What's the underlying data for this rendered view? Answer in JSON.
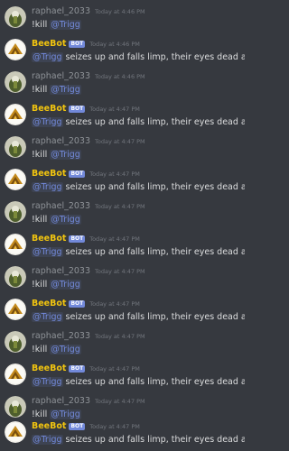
{
  "messages": [
    {
      "author": "raphael_2033",
      "type": "user",
      "time": "Today at 4:46 PM",
      "prefix": "!kill ",
      "mention": "@Trigg",
      "suffix": ""
    },
    {
      "author": "BeeBot",
      "type": "bot",
      "badge": "BOT",
      "time": "Today at 4:46 PM",
      "prefix": "",
      "mention": "@Trigg",
      "suffix": " seizes up and falls limp, their eyes dead and lifeless..."
    },
    {
      "author": "raphael_2033",
      "type": "user",
      "time": "Today at 4:46 PM",
      "prefix": "!kill ",
      "mention": "@Trigg",
      "suffix": ""
    },
    {
      "author": "BeeBot",
      "type": "bot",
      "badge": "BOT",
      "time": "Today at 4:47 PM",
      "prefix": "",
      "mention": "@Trigg",
      "suffix": " seizes up and falls limp, their eyes dead and lifeless..."
    },
    {
      "author": "raphael_2033",
      "type": "user",
      "time": "Today at 4:47 PM",
      "prefix": "!kill ",
      "mention": "@Trigg",
      "suffix": ""
    },
    {
      "author": "BeeBot",
      "type": "bot",
      "badge": "BOT",
      "time": "Today at 4:47 PM",
      "prefix": "",
      "mention": "@Trigg",
      "suffix": " seizes up and falls limp, their eyes dead and lifeless..."
    },
    {
      "author": "raphael_2033",
      "type": "user",
      "time": "Today at 4:47 PM",
      "prefix": "!kill ",
      "mention": "@Trigg",
      "suffix": ""
    },
    {
      "author": "BeeBot",
      "type": "bot",
      "badge": "BOT",
      "time": "Today at 4:47 PM",
      "prefix": "",
      "mention": "@Trigg",
      "suffix": " seizes up and falls limp, their eyes dead and lifeless..."
    },
    {
      "author": "raphael_2033",
      "type": "user",
      "time": "Today at 4:47 PM",
      "prefix": "!kill ",
      "mention": "@Trigg",
      "suffix": ""
    },
    {
      "author": "BeeBot",
      "type": "bot",
      "badge": "BOT",
      "time": "Today at 4:47 PM",
      "prefix": "",
      "mention": "@Trigg",
      "suffix": " seizes up and falls limp, their eyes dead and lifeless..."
    },
    {
      "author": "raphael_2033",
      "type": "user",
      "time": "Today at 4:47 PM",
      "prefix": "!kill ",
      "mention": "@Trigg",
      "suffix": ""
    },
    {
      "author": "BeeBot",
      "type": "bot",
      "badge": "BOT",
      "time": "Today at 4:47 PM",
      "prefix": "",
      "mention": "@Trigg",
      "suffix": " seizes up and falls limp, their eyes dead and lifeless..."
    },
    {
      "author": "raphael_2033",
      "type": "user",
      "time": "Today at 4:47 PM",
      "prefix": "!kill ",
      "mention": "@Trigg",
      "suffix": ""
    },
    {
      "author": "BeeBot",
      "type": "bot",
      "badge": "BOT",
      "time": "Today at 4:47 PM",
      "prefix": "",
      "mention": "@Trigg",
      "suffix": " seizes up and falls limp, their eyes dead and lifeless..."
    }
  ],
  "colors": {
    "background": "#36393f",
    "bot_name": "#f1c40f",
    "user_name": "#8e9297",
    "mention": "#7289da",
    "timestamp": "#72767d",
    "bot_badge": "#7289da"
  },
  "icons": {
    "user_avatar": "user-avatar-icon",
    "bot_avatar": "bee-avatar-icon"
  }
}
